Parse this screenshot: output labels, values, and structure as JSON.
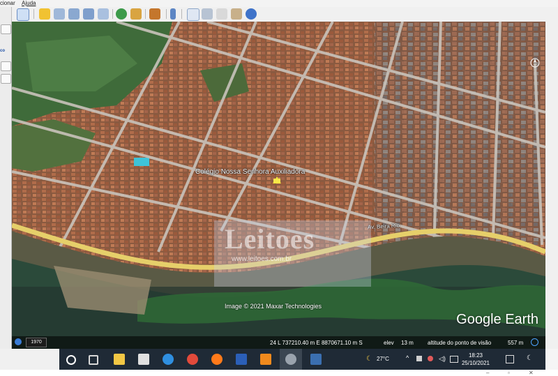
{
  "menu": {
    "item1": "cionar",
    "item2": "Ajuda"
  },
  "left_panel": {
    "label": "co"
  },
  "map": {
    "place_label": "Colégio Nossa Senhora Auxiliadora",
    "road_label_right": "Av. Beira Rio",
    "watermark_text": "Leitoes",
    "watermark_url": "www.leitoes.com.br",
    "copyright": "Image © 2021 Maxar Technologies",
    "logo": "Google Earth"
  },
  "status_bar": {
    "year": "1970",
    "coords": "24 L 737210.40 m E 8870671.10 m S",
    "elev_label": "elev",
    "elev_value": "13 m",
    "eye_label": "altitude do ponto de visão",
    "eye_value": "557 m"
  },
  "taskbar": {
    "weather": "27°C",
    "time": "18:23",
    "date": "25/10/2021"
  },
  "colors": {
    "taskbar": "#1f2a36",
    "road_yellow": "#e8d26b",
    "water": "#2a3a3a"
  }
}
